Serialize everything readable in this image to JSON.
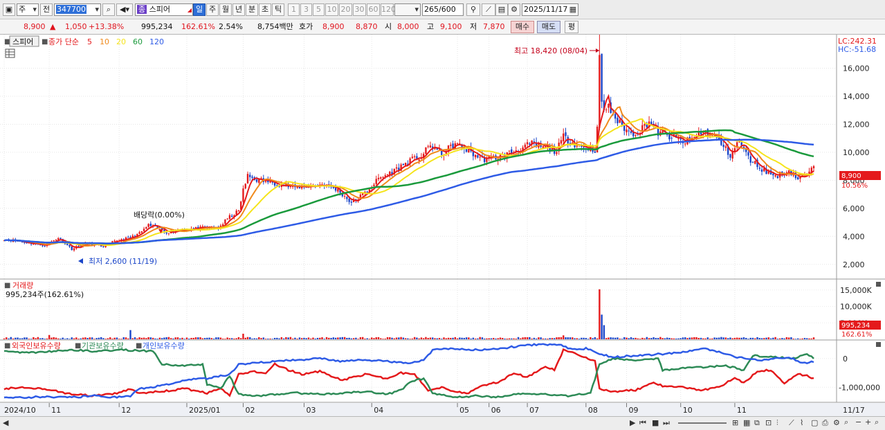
{
  "toolbar": {
    "period_type": "주",
    "prev_label": "전",
    "stock_code": "347700",
    "stock_badge": "종",
    "stock_name": "스피어",
    "periods": [
      {
        "label": "일",
        "selected": true
      },
      {
        "label": "주",
        "selected": false
      },
      {
        "label": "월",
        "selected": false
      },
      {
        "label": "년",
        "selected": false
      },
      {
        "label": "분",
        "selected": false
      },
      {
        "label": "초",
        "selected": false
      },
      {
        "label": "틱",
        "selected": false
      }
    ],
    "intervals": [
      "1",
      "3",
      "5",
      "10",
      "20",
      "30",
      "60",
      "120"
    ],
    "count": "265",
    "total": "/600",
    "date": "2025/11/17"
  },
  "quote": {
    "price": "8,900",
    "change": "1,050",
    "change_pct": "+13.38%",
    "volume": "995,234",
    "volume_ratio": "162.61%",
    "turnover": "2.54%",
    "amount": "8,754백만",
    "ask_label": "호가",
    "bid1": "8,900",
    "bid2": "8,870",
    "open_label": "시",
    "open": "8,000",
    "high_label": "고",
    "high": "9,100",
    "low_label": "저",
    "low": "7,870",
    "buy_label": "매수",
    "sell_label": "매도",
    "eval_label": "평"
  },
  "legend": {
    "stock": "스피어",
    "ma_title": "종가 단순",
    "ma_periods": [
      "5",
      "10",
      "20",
      "60",
      "120"
    ],
    "ma_colors": [
      "#e41a1c",
      "#f08a1c",
      "#f5e41c",
      "#1a9a3c",
      "#2e5be6"
    ]
  },
  "annotations": {
    "lc": "LC:242.31",
    "hc": "HC:-51.68",
    "max_label": "최고 18,420 (08/04)",
    "min_label": "최저 2,600 (11/19)",
    "dividend_label": "배당락(0.00%)",
    "price_tag": "8,900",
    "price_tag_pct": "10.56%",
    "vol_tag": "995,234",
    "vol_tag_pct": "162.61%"
  },
  "volume_panel": {
    "title": "거래량",
    "info": "995,234주(162.61%)"
  },
  "holdings_panel": {
    "foreign": "외국인보유수량",
    "institution": "기관보유수량",
    "individual": "개인보유수량"
  },
  "x_axis": [
    "2024/10",
    "11",
    "12",
    "2025/01",
    "02",
    "03",
    "04",
    "05",
    "06",
    "07",
    "08",
    "09",
    "10",
    "11",
    "11/17"
  ],
  "chart_data": [
    {
      "type": "candlestick",
      "title": "스피어",
      "ylim": [
        1000,
        18400
      ],
      "yticks": [
        "2,000",
        "4,000",
        "6,000",
        "8,000",
        "10,000",
        "12,000",
        "14,000",
        "16,000"
      ],
      "anchors": [
        [
          0,
          3800
        ],
        [
          8,
          3600
        ],
        [
          18,
          3350
        ],
        [
          24,
          3900
        ],
        [
          30,
          3100
        ],
        [
          36,
          3500
        ],
        [
          44,
          3300
        ],
        [
          50,
          3700
        ],
        [
          56,
          3900
        ],
        [
          60,
          4200
        ],
        [
          64,
          4800
        ],
        [
          68,
          4600
        ],
        [
          72,
          4300
        ],
        [
          80,
          4500
        ],
        [
          88,
          4600
        ],
        [
          95,
          4600
        ],
        [
          100,
          5400
        ],
        [
          104,
          5800
        ],
        [
          106,
          7300
        ],
        [
          108,
          8300
        ],
        [
          112,
          8050
        ],
        [
          118,
          7900
        ],
        [
          128,
          7500
        ],
        [
          135,
          7600
        ],
        [
          142,
          7700
        ],
        [
          148,
          7300
        ],
        [
          154,
          6400
        ],
        [
          160,
          7100
        ],
        [
          166,
          8100
        ],
        [
          172,
          8600
        ],
        [
          180,
          9400
        ],
        [
          185,
          9700
        ],
        [
          189,
          10500
        ],
        [
          194,
          9900
        ],
        [
          200,
          10600
        ],
        [
          204,
          10300
        ],
        [
          212,
          9500
        ],
        [
          220,
          9700
        ],
        [
          228,
          10200
        ],
        [
          234,
          10600
        ],
        [
          240,
          10300
        ],
        [
          245,
          10100
        ],
        [
          248,
          11100
        ],
        [
          252,
          10700
        ],
        [
          256,
          10400
        ],
        [
          262,
          10200
        ],
        [
          264,
          13000
        ],
        [
          268,
          13200
        ],
        [
          272,
          12200
        ],
        [
          278,
          11300
        ],
        [
          282,
          11600
        ],
        [
          286,
          12200
        ],
        [
          290,
          11400
        ],
        [
          294,
          11200
        ],
        [
          302,
          10700
        ],
        [
          310,
          11500
        ],
        [
          316,
          11000
        ],
        [
          322,
          9800
        ],
        [
          326,
          10800
        ],
        [
          330,
          9600
        ],
        [
          336,
          8800
        ],
        [
          342,
          8300
        ],
        [
          348,
          8700
        ],
        [
          352,
          8100
        ],
        [
          357,
          8500
        ],
        [
          359,
          8900
        ]
      ],
      "spikes": [
        [
          264,
          18420
        ],
        [
          265,
          14800
        ]
      ],
      "max": {
        "index": 264,
        "value": 18420,
        "label": "최고 18,420 (08/04)"
      },
      "min": {
        "index": 32,
        "value": 2600,
        "label": "최저 2,600 (11/19)"
      }
    },
    {
      "type": "bar",
      "title": "거래량",
      "ylim": [
        0,
        16000
      ],
      "yticks": [
        "5,000K",
        "10,000K",
        "15,000K"
      ],
      "spikes": [
        [
          264,
          15200
        ],
        [
          265,
          7500
        ],
        [
          266,
          4300
        ],
        [
          56,
          2800
        ],
        [
          20,
          1300
        ],
        [
          106,
          1700
        ],
        [
          248,
          1200
        ]
      ]
    },
    {
      "type": "line",
      "title": "보유수량",
      "ylim": [
        -1500000,
        500000
      ],
      "yticks": [
        "0",
        "-1,000,000"
      ],
      "series": [
        {
          "name": "외국인보유수량",
          "color": "#e41a1c",
          "anchors": [
            [
              0,
              -1.05
            ],
            [
              10,
              -1.0
            ],
            [
              20,
              -1.08
            ],
            [
              30,
              -1.25
            ],
            [
              40,
              -1.3
            ],
            [
              50,
              -1.22
            ],
            [
              56,
              -1.05
            ],
            [
              60,
              -1.2
            ],
            [
              70,
              -1.15
            ],
            [
              80,
              -1.05
            ],
            [
              90,
              -1.2
            ],
            [
              96,
              -1.05
            ],
            [
              100,
              -1.3
            ],
            [
              104,
              -0.55
            ],
            [
              110,
              -0.45
            ],
            [
              116,
              -0.5
            ],
            [
              120,
              -0.2
            ],
            [
              126,
              -0.4
            ],
            [
              132,
              -0.55
            ],
            [
              140,
              -0.45
            ],
            [
              150,
              -0.75
            ],
            [
              160,
              -0.55
            ],
            [
              170,
              -0.7
            ],
            [
              176,
              -0.5
            ],
            [
              182,
              -0.55
            ],
            [
              188,
              -1.1
            ],
            [
              194,
              -1.0
            ],
            [
              200,
              -1.15
            ],
            [
              206,
              -1.2
            ],
            [
              212,
              -0.95
            ],
            [
              220,
              -0.8
            ],
            [
              226,
              -0.5
            ],
            [
              232,
              -0.65
            ],
            [
              240,
              -0.3
            ],
            [
              244,
              -0.4
            ],
            [
              248,
              0.3
            ],
            [
              252,
              0.2
            ],
            [
              256,
              0.1
            ],
            [
              262,
              -0.1
            ],
            [
              264,
              -1.05
            ],
            [
              270,
              -1.15
            ],
            [
              280,
              -1.1
            ],
            [
              288,
              -0.85
            ],
            [
              292,
              -0.95
            ],
            [
              300,
              -1.0
            ],
            [
              310,
              -1.1
            ],
            [
              318,
              -0.95
            ],
            [
              324,
              -0.65
            ],
            [
              328,
              -0.85
            ],
            [
              334,
              -0.45
            ],
            [
              340,
              -0.4
            ],
            [
              346,
              -0.85
            ],
            [
              352,
              -0.55
            ],
            [
              356,
              -0.6
            ],
            [
              359,
              -0.7
            ]
          ]
        },
        {
          "name": "기관보유수량",
          "color": "#2e8b57",
          "anchors": [
            [
              0,
              0.25
            ],
            [
              10,
              0.2
            ],
            [
              20,
              0.25
            ],
            [
              30,
              0.3
            ],
            [
              40,
              0.25
            ],
            [
              50,
              0.3
            ],
            [
              60,
              0.28
            ],
            [
              66,
              0.25
            ],
            [
              70,
              -0.2
            ],
            [
              80,
              -0.25
            ],
            [
              88,
              -0.2
            ],
            [
              90,
              -0.9
            ],
            [
              96,
              -1.05
            ],
            [
              100,
              -0.6
            ],
            [
              104,
              -1.25
            ],
            [
              112,
              -1.3
            ],
            [
              120,
              -1.25
            ],
            [
              130,
              -1.2
            ],
            [
              140,
              -1.25
            ],
            [
              150,
              -1.2
            ],
            [
              160,
              -1.15
            ],
            [
              170,
              -1.25
            ],
            [
              176,
              -1.1
            ],
            [
              180,
              -0.8
            ],
            [
              186,
              -0.7
            ],
            [
              190,
              -1.2
            ],
            [
              200,
              -1.35
            ],
            [
              210,
              -1.3
            ],
            [
              220,
              -1.35
            ],
            [
              230,
              -1.2
            ],
            [
              240,
              -1.25
            ],
            [
              250,
              -1.3
            ],
            [
              260,
              -1.2
            ],
            [
              264,
              -0.2
            ],
            [
              270,
              0.0
            ],
            [
              280,
              -0.05
            ],
            [
              290,
              0.0
            ],
            [
              292,
              -0.4
            ],
            [
              300,
              -0.35
            ],
            [
              310,
              -0.3
            ],
            [
              320,
              -0.25
            ],
            [
              328,
              -0.4
            ],
            [
              332,
              0.1
            ],
            [
              340,
              0.05
            ],
            [
              350,
              0.0
            ],
            [
              356,
              0.15
            ],
            [
              359,
              0.0
            ]
          ]
        },
        {
          "name": "개인보유수량",
          "color": "#2e5be6",
          "anchors": [
            [
              0,
              -1.35
            ],
            [
              10,
              -1.35
            ],
            [
              20,
              -1.33
            ],
            [
              30,
              -1.35
            ],
            [
              40,
              -1.3
            ],
            [
              50,
              -1.35
            ],
            [
              56,
              -1.3
            ],
            [
              60,
              -1.05
            ],
            [
              70,
              -0.95
            ],
            [
              80,
              -0.75
            ],
            [
              90,
              -0.7
            ],
            [
              100,
              -0.55
            ],
            [
              104,
              -0.2
            ],
            [
              112,
              -0.15
            ],
            [
              120,
              -0.1
            ],
            [
              130,
              -0.05
            ],
            [
              140,
              0.0
            ],
            [
              150,
              -0.1
            ],
            [
              160,
              -0.05
            ],
            [
              170,
              -0.1
            ],
            [
              180,
              -0.15
            ],
            [
              186,
              -0.05
            ],
            [
              190,
              0.3
            ],
            [
              200,
              0.35
            ],
            [
              210,
              0.3
            ],
            [
              220,
              0.35
            ],
            [
              230,
              0.45
            ],
            [
              240,
              0.5
            ],
            [
              248,
              0.45
            ],
            [
              252,
              0.3
            ],
            [
              258,
              0.35
            ],
            [
              264,
              0.15
            ],
            [
              270,
              0.05
            ],
            [
              280,
              0.1
            ],
            [
              290,
              0.15
            ],
            [
              300,
              0.2
            ],
            [
              310,
              0.35
            ],
            [
              318,
              0.2
            ],
            [
              324,
              0.05
            ],
            [
              330,
              0.0
            ],
            [
              336,
              -0.05
            ],
            [
              342,
              0.0
            ],
            [
              348,
              0.05
            ],
            [
              352,
              -0.1
            ],
            [
              356,
              -0.15
            ],
            [
              359,
              -0.1
            ]
          ]
        }
      ]
    }
  ]
}
